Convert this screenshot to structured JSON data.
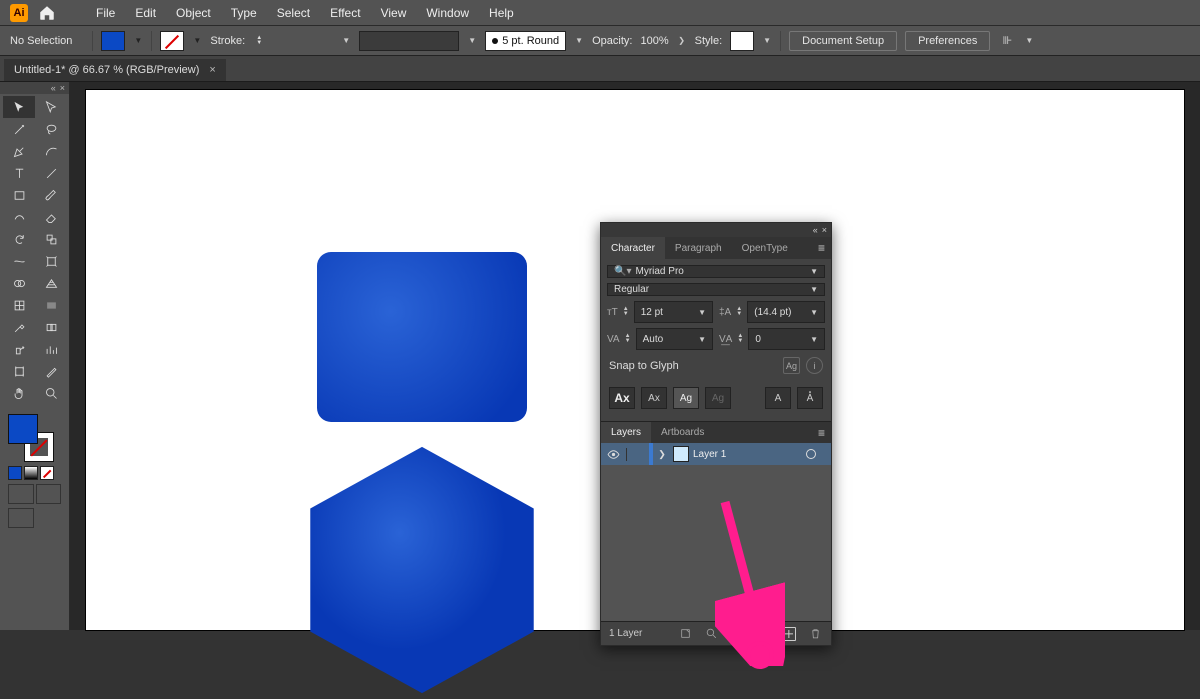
{
  "app": {
    "logo_letter": "Ai"
  },
  "menubar": {
    "items": [
      "File",
      "Edit",
      "Object",
      "Type",
      "Select",
      "Effect",
      "View",
      "Window",
      "Help"
    ]
  },
  "controlbar": {
    "selection": "No Selection",
    "stroke_label": "Stroke:",
    "brush_profile": "5 pt. Round",
    "opacity_label": "Opacity:",
    "opacity_value": "100%",
    "style_label": "Style:",
    "doc_setup": "Document Setup",
    "preferences": "Preferences"
  },
  "document": {
    "tab_title": "Untitled-1* @ 66.67 % (RGB/Preview)"
  },
  "char_panel": {
    "tabs": [
      "Character",
      "Paragraph",
      "OpenType"
    ],
    "font_family": "Myriad Pro",
    "font_style": "Regular",
    "font_size": "12 pt",
    "leading": "(14.4 pt)",
    "kerning": "Auto",
    "tracking": "0",
    "snap_label": "Snap to Glyph"
  },
  "layers_panel": {
    "tabs": [
      "Layers",
      "Artboards"
    ],
    "layer_name": "Layer 1",
    "footer_count": "1 Layer"
  }
}
